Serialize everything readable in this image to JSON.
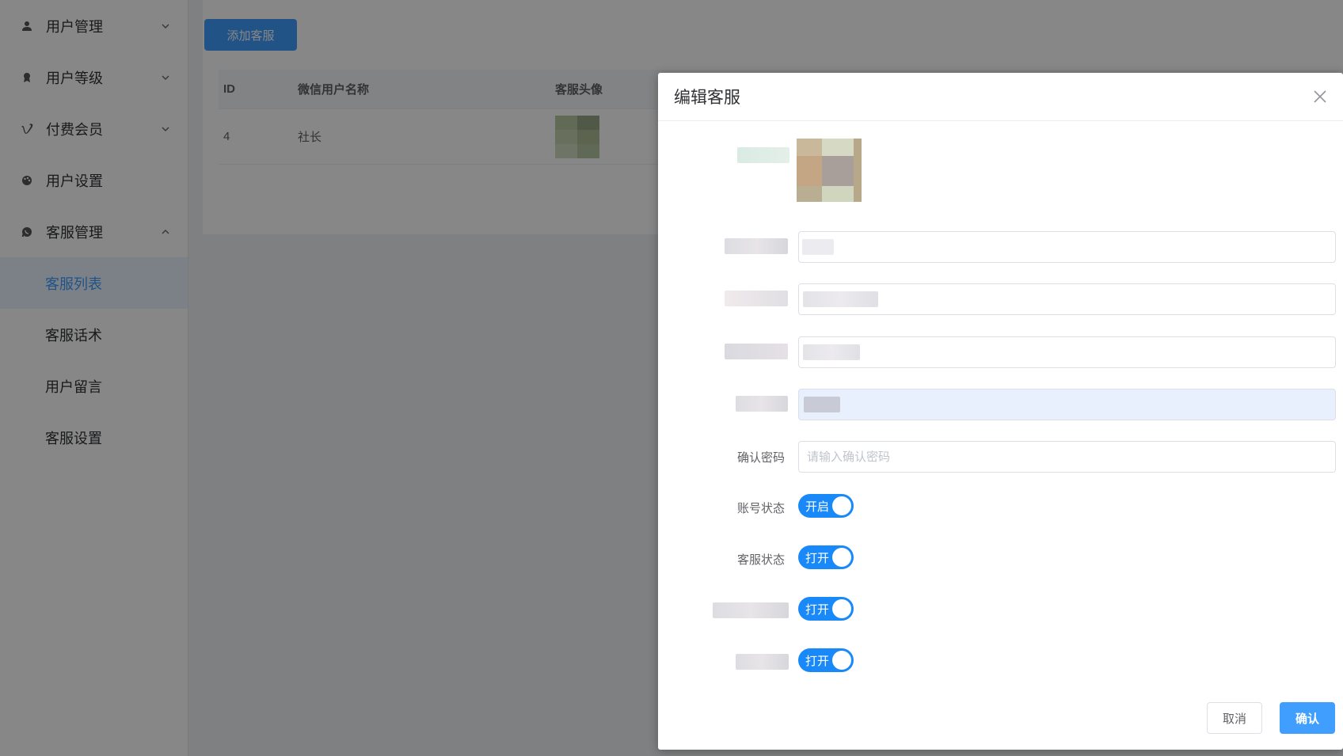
{
  "sidebar": {
    "items": [
      {
        "label": "用户管理",
        "icon": "user-icon",
        "expanded": false
      },
      {
        "label": "用户等级",
        "icon": "rank-icon",
        "expanded": false
      },
      {
        "label": "付费会员",
        "icon": "vimeo-icon",
        "expanded": false
      },
      {
        "label": "用户设置",
        "icon": "palette-icon"
      },
      {
        "label": "客服管理",
        "icon": "whatsapp-icon",
        "expanded": true
      }
    ],
    "sub_items": [
      {
        "label": "客服列表",
        "active": true
      },
      {
        "label": "客服话术"
      },
      {
        "label": "用户留言"
      },
      {
        "label": "客服设置"
      }
    ]
  },
  "main": {
    "add_button": "添加客服",
    "table": {
      "headers": [
        "ID",
        "微信用户名称",
        "客服头像"
      ],
      "rows": [
        {
          "id": "4",
          "name": "社长"
        }
      ]
    }
  },
  "dialog": {
    "title": "编辑客服",
    "confirm_password_label": "确认密码",
    "confirm_password_placeholder": "请输入确认密码",
    "account_status_label": "账号状态",
    "account_status_text": "开启",
    "service_status_label": "客服状态",
    "service_status_text": "打开",
    "switch3_text": "打开",
    "switch4_text": "打开",
    "cancel": "取消",
    "confirm": "确认"
  },
  "colors": {
    "primary": "#409eff",
    "switch_on": "#1989fa",
    "active_bg": "#e8f3ff"
  }
}
